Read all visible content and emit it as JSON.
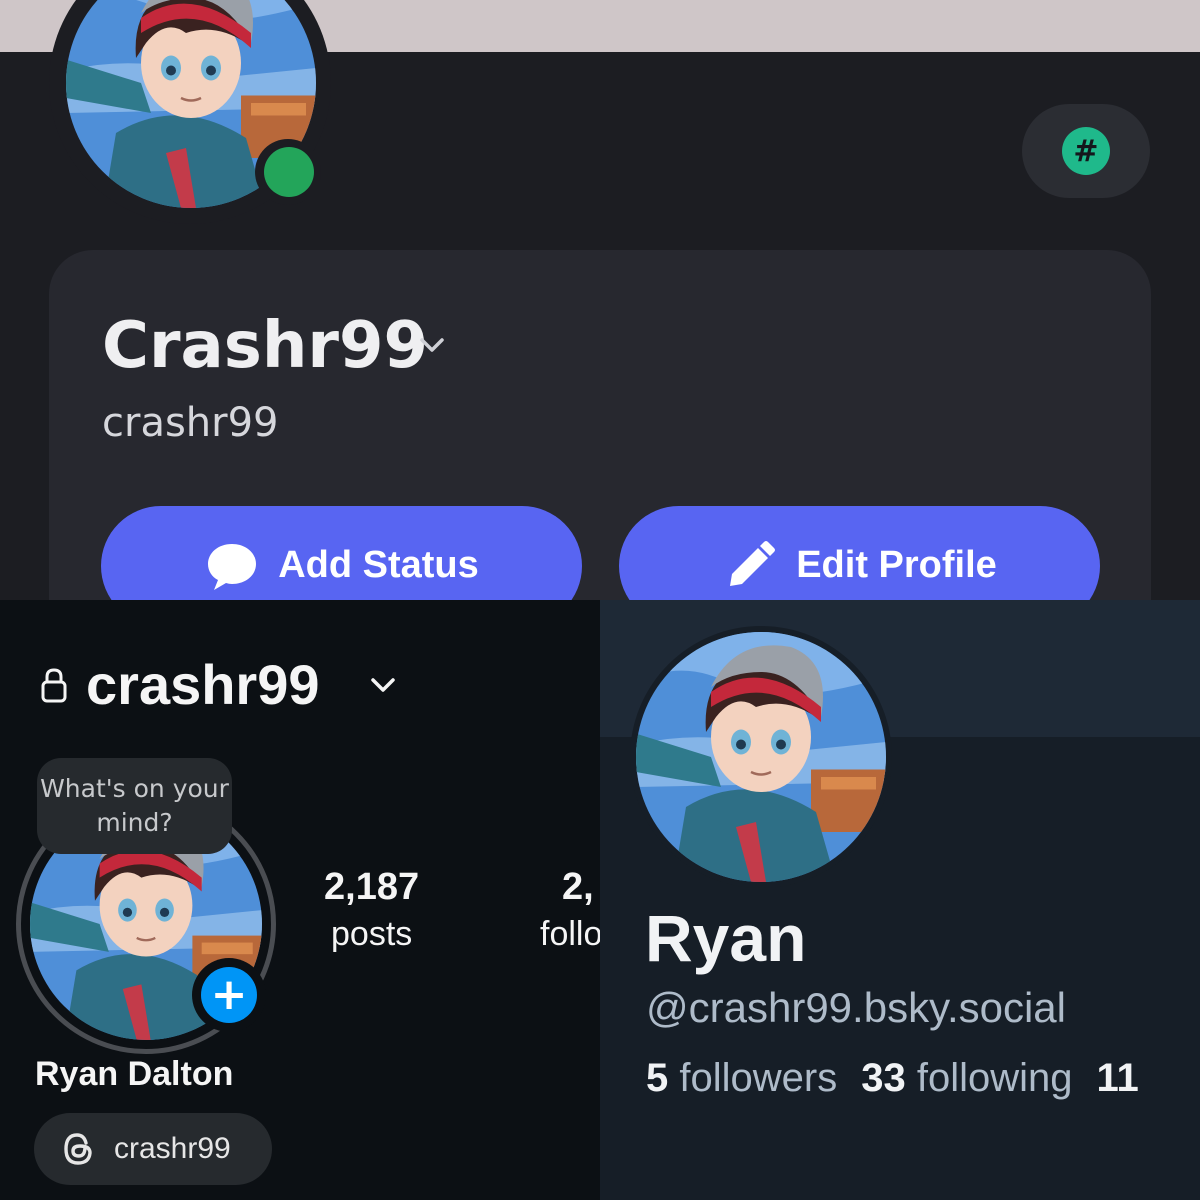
{
  "discord": {
    "display_name": "Crashr99",
    "username": "crashr99",
    "add_status_label": "Add Status",
    "edit_profile_label": "Edit Profile",
    "nitro_badge": "#",
    "status": "online",
    "colors": {
      "accent": "#5865f2",
      "online": "#23a55a",
      "badge": "#1fb98b"
    },
    "icons": {
      "status_button": "speech-bubble-icon",
      "edit_button": "pencil-icon",
      "name_menu": "chevron-down-icon"
    }
  },
  "instagram": {
    "handle": "crashr99",
    "note_bubble": "What's on your mind?",
    "stats": [
      {
        "value": "2,187",
        "label": "posts"
      },
      {
        "value": "2,",
        "label": "follo"
      }
    ],
    "full_name": "Ryan Dalton",
    "threads_handle": "crashr99",
    "colors": {
      "accent": "#0095f6"
    },
    "icons": {
      "privacy": "lock-icon",
      "add_story": "plus-icon",
      "threads": "threads-logo-icon"
    }
  },
  "bluesky": {
    "display_name": "Ryan",
    "handle": "@crashr99.bsky.social",
    "followers_count": "5",
    "followers_label": "followers",
    "following_count": "33",
    "following_label": "following",
    "posts_count_partial": "11"
  }
}
